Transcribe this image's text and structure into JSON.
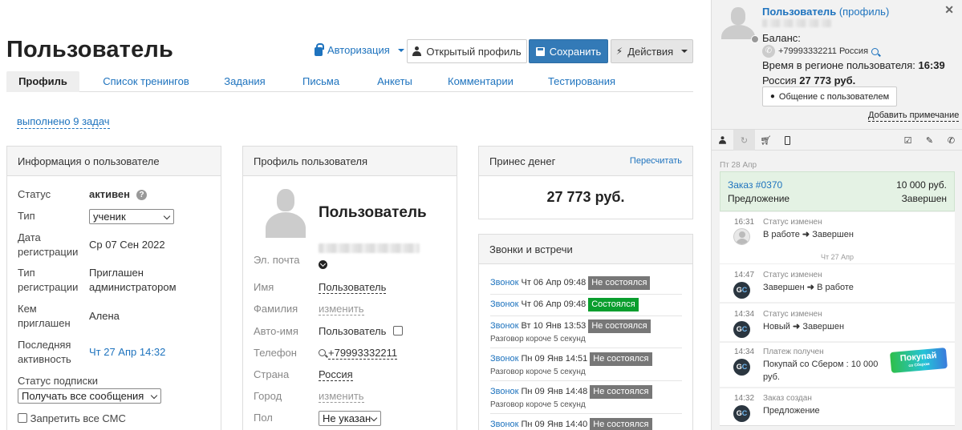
{
  "header": {
    "title": "Пользователь",
    "auth_label": "Авторизация",
    "open_profile_label": "Открытый профиль",
    "save_label": "Сохранить",
    "actions_label": "Действия"
  },
  "tabs": [
    {
      "label": "Профиль"
    },
    {
      "label": "Список тренингов"
    },
    {
      "label": "Задания"
    },
    {
      "label": "Письма"
    },
    {
      "label": "Анкеты"
    },
    {
      "label": "Комментарии"
    },
    {
      "label": "Тестирования"
    }
  ],
  "tasks_link": "выполнено 9 задач",
  "info_panel": {
    "title": "Информация о пользователе",
    "status_label": "Статус",
    "status_value": "активен",
    "help_icon": "?",
    "type_label": "Тип",
    "type_value": "ученик",
    "reg_date_label_1": "Дата",
    "reg_date_label_2": "регистрации",
    "reg_date_value": "Ср 07 Сен 2022",
    "reg_type_label_1": "Тип",
    "reg_type_label_2": "регистрации",
    "reg_type_value_1": "Приглашен",
    "reg_type_value_2": "администратором",
    "invited_label_1": "Кем",
    "invited_label_2": "приглашен",
    "invited_value": "Алена",
    "last_active_label_1": "Последняя",
    "last_active_label_2": "активность",
    "last_active_value": "Чт 27 Апр 14:32",
    "sub_label": "Статус подписки",
    "sub_value": "Получать все сообщения",
    "sms_label": "Запретить все СМС"
  },
  "profile_panel": {
    "title": "Профиль пользователя",
    "name_big": "Пользователь",
    "email_label": "Эл. почта",
    "first_name_label": "Имя",
    "first_name_value": "Пользователь",
    "last_name_label": "Фамилия",
    "change_label": "изменить",
    "auto_name_label": "Авто-имя",
    "auto_name_value": "Пользователь",
    "phone_label": "Телефон",
    "phone_value": "+79993332211",
    "country_label": "Страна",
    "country_value": "Россия",
    "city_label": "Город",
    "city_value": "изменить",
    "gender_label": "Пол",
    "gender_value": "Не указан"
  },
  "money_panel": {
    "title": "Принес денег",
    "recalc_label": "Пересчитать",
    "amount": "27 773 руб."
  },
  "calls_panel": {
    "title": "Звонки и встречи",
    "calls": [
      {
        "link": "Звонок",
        "date": "Чт 06 Апр 09:48",
        "status": "Не состоялся",
        "status_color": "#777777",
        "note": ""
      },
      {
        "link": "Звонок",
        "date": "Чт 06 Апр 09:48",
        "status": "Состоялся",
        "status_color": "#0a9e2e",
        "note": ""
      },
      {
        "link": "Звонок",
        "date": "Вт 10 Янв 13:53",
        "status": "Не состоялся",
        "status_color": "#777777",
        "note": "Разговор короче 5 секунд"
      },
      {
        "link": "Звонок",
        "date": "Пн 09 Янв 14:51",
        "status": "Не состоялся",
        "status_color": "#777777",
        "note": "Разговор короче 5 секунд"
      },
      {
        "link": "Звонок",
        "date": "Пн 09 Янв 14:48",
        "status": "Не состоялся",
        "status_color": "#777777",
        "note": "Разговор короче 5 секунд"
      },
      {
        "link": "Звонок",
        "date": "Пн 09 Янв 14:40",
        "status": "Не состоялся",
        "status_color": "#777777",
        "note": ""
      }
    ]
  },
  "sidebar": {
    "user_link": "Пользователь",
    "profile_link": "(профиль)",
    "balance_label": "Баланс:",
    "phone": "+79993332211 Россия",
    "region_time_label": "Время в регионе пользователя:",
    "region_time_value": "16:39",
    "country_sum_label": "Россия",
    "country_sum_value": "27 773 руб.",
    "chat_button": "Общение с пользователем",
    "add_note": "Добавить примечание",
    "date_divider_1": "Пт 28 Апр",
    "order_link": "Заказ #0370",
    "order_amount": "10 000 руб.",
    "order_type": "Предложение",
    "order_status": "Завершен",
    "date_divider_2": "Чт 27 Апр",
    "events": [
      {
        "time": "16:31",
        "title": "Статус изменен",
        "text_from": "В работе",
        "text_to": "Завершен"
      },
      {
        "time": "14:47",
        "title": "Статус изменен",
        "text_from": "Завершен",
        "text_to": "В работе"
      },
      {
        "time": "14:34",
        "title": "Статус изменен",
        "text_from": "Новый",
        "text_to": "Завершен"
      },
      {
        "time": "14:34",
        "title": "Платеж получен",
        "text_line1": "Покупай со Сбером : 10 000",
        "text_line2": "руб.",
        "badge": "Покупай",
        "badge_sub": "со Сбером"
      },
      {
        "time": "14:32",
        "title": "Заказ создан",
        "text_line1": "Предложение"
      }
    ],
    "gc_label": "GC"
  },
  "colors": {
    "accent": "#1e73be",
    "save_button": "#337ab7",
    "success": "#0a9e2e",
    "order_bg": "#e4f2e4"
  }
}
